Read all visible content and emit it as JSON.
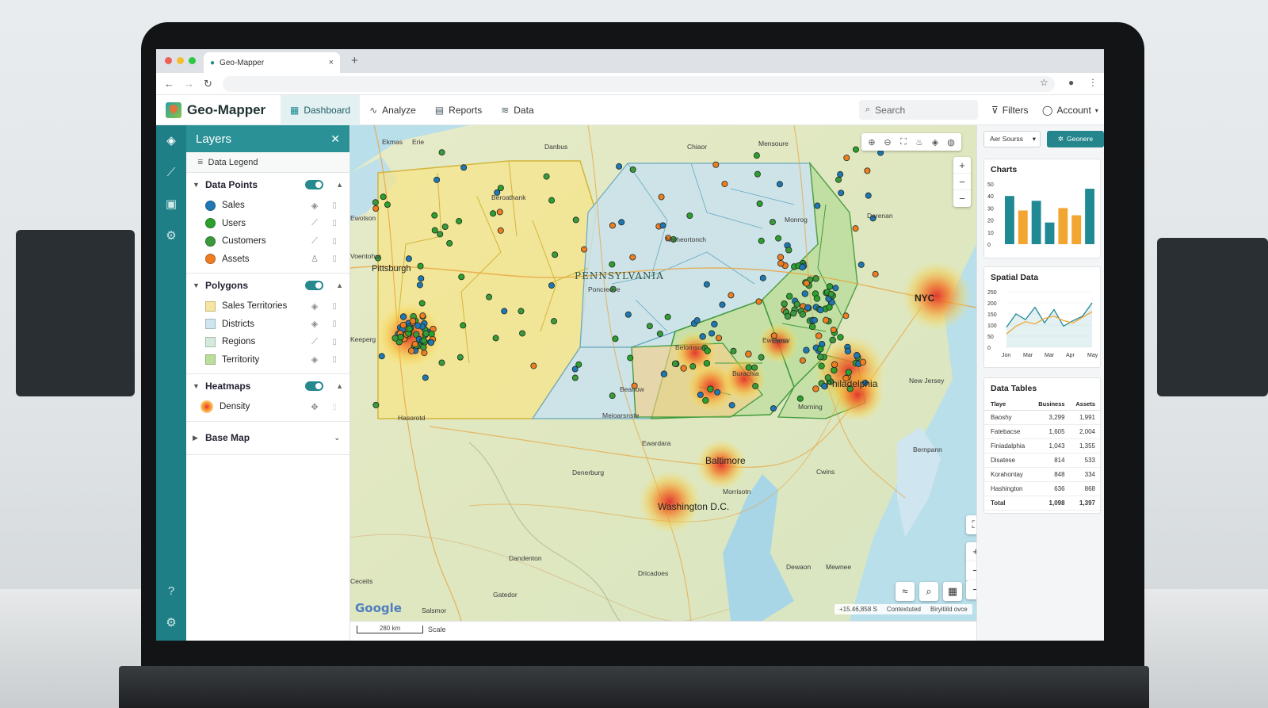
{
  "browser": {
    "tab_title": "Geo-Mapper",
    "tab_close": "×",
    "new_tab": "+",
    "nav_back": "←",
    "nav_forward": "→",
    "nav_reload": "↻",
    "star": "☆",
    "profile": "●",
    "menu": "⋮"
  },
  "app": {
    "name": "Geo-Mapper",
    "nav": [
      {
        "label": "Dashboard",
        "icon": "dashboard-icon"
      },
      {
        "label": "Analyze",
        "icon": "line-chart-icon"
      },
      {
        "label": "Reports",
        "icon": "document-icon"
      },
      {
        "label": "Data",
        "icon": "database-icon"
      }
    ],
    "search_placeholder": "Search",
    "filters_label": "Filters",
    "account_label": "Account"
  },
  "layers_panel": {
    "title": "Layers",
    "legend_tab": "Data Legend",
    "sections": [
      {
        "title": "Data Points",
        "enabled": true,
        "items": [
          {
            "label": "Sales",
            "color": "#1f77b4"
          },
          {
            "label": "Users",
            "color": "#2ca02c"
          },
          {
            "label": "Customers",
            "color": "#3a9a3a"
          },
          {
            "label": "Assets",
            "color": "#ef7d22"
          }
        ]
      },
      {
        "title": "Polygons",
        "enabled": true,
        "items": [
          {
            "label": "Sales Territories",
            "color": "#f8e6a0"
          },
          {
            "label": "Districts",
            "color": "#cfe5ef"
          },
          {
            "label": "Regions",
            "color": "#d4ebdc"
          },
          {
            "label": "Territority",
            "color": "#b9df9b"
          }
        ]
      },
      {
        "title": "Heatmaps",
        "enabled": true,
        "items": [
          {
            "label": "Density"
          }
        ]
      }
    ],
    "base_map_label": "Base Map"
  },
  "map": {
    "state_label": "PENNSYLVANIA",
    "city_labels": [
      "Pittsburgh",
      "NYC",
      "Philadelphia",
      "Baltimore",
      "Washington D.C."
    ],
    "minor_labels": [
      "Erie",
      "Danbus",
      "Chiaor",
      "Mensoure",
      "Beroathank",
      "Natheortonch",
      "Poncreove",
      "Monrog",
      "Derenan",
      "Morning",
      "New Jersey",
      "Meioarsnste",
      "Ewardara",
      "Denerburg",
      "Dandenton",
      "Dricadoes",
      "Gatedor",
      "Salsmor",
      "Morrisotn",
      "Keeperg",
      "Voentohur",
      "Beanow",
      "Burachia",
      "Belomson",
      "Ewcenov",
      "Ewos",
      "Cwins",
      "Bernpann",
      "Dewaon",
      "Mewnee",
      "Hasorotd",
      "Ceceits",
      "Ewolson",
      "Ekmas"
    ],
    "google_label": "Google",
    "scale_label": "280 km",
    "scale_text": "Scale",
    "coords": "+15.46,858 S",
    "status_1": "Contextuted",
    "status_2": "Biryitiild ovce"
  },
  "right_panel": {
    "source_select": "Aer Sourss",
    "generate_label": "Geonere",
    "charts_title": "Charts",
    "spatial_title": "Spatial Data",
    "tables_title": "Data Tables",
    "table": {
      "headers": [
        "Tlaye",
        "Business",
        "Assets"
      ],
      "rows": [
        [
          "Baoshy",
          "3,299",
          "1,991"
        ],
        [
          "Fatebacse",
          "1,605",
          "2,004"
        ],
        [
          "Finiadalphia",
          "1,043",
          "1,355"
        ],
        [
          "Disatese",
          "814",
          "533"
        ],
        [
          "Korahontay",
          "848",
          "334"
        ],
        [
          "Hashington",
          "636",
          "868"
        ],
        [
          "Total",
          "1,098",
          "1,397"
        ]
      ]
    }
  },
  "chart_data": [
    {
      "type": "bar",
      "title": "Charts",
      "ylim": [
        0,
        50
      ],
      "yticks": [
        "0",
        "10",
        "20",
        "30",
        "40",
        "50"
      ],
      "values": [
        40,
        28,
        36,
        18,
        30,
        24,
        46
      ],
      "colors": [
        "#1f8a93",
        "#f2a531",
        "#1f8a93",
        "#1f8a93",
        "#f2a531",
        "#f2a531",
        "#1f8a93"
      ]
    },
    {
      "type": "line",
      "title": "Spatial Data",
      "ylim": [
        0,
        250
      ],
      "yticks": [
        "0",
        "50",
        "100",
        "150",
        "200",
        "250"
      ],
      "xticks": [
        "Jon",
        "Mar",
        "Mar",
        "Apr",
        "May"
      ],
      "series": [
        {
          "values": [
            90,
            150,
            125,
            180,
            110,
            170,
            95,
            120,
            140,
            200
          ],
          "color": "#1f8a93"
        },
        {
          "values": [
            60,
            95,
            115,
            105,
            130,
            140,
            120,
            110,
            135,
            160
          ],
          "color": "#f2a531"
        }
      ]
    }
  ]
}
